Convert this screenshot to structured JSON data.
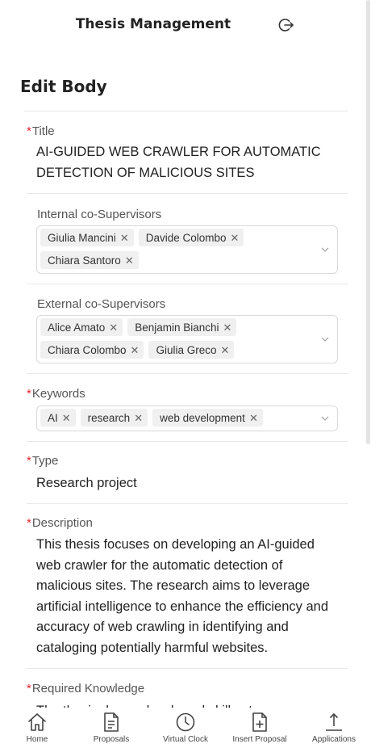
{
  "header": {
    "title": "Thesis Management",
    "logout_icon": "logout-icon"
  },
  "page": {
    "title": "Edit Body"
  },
  "form": {
    "title": {
      "label": "Title",
      "required": "*",
      "value": "AI-GUIDED WEB CRAWLER FOR AUTOMATIC DETECTION OF MALICIOUS SITES"
    },
    "internal": {
      "label": "Internal co-Supervisors",
      "tags": [
        "Giulia Mancini",
        "Davide Colombo",
        "Chiara Santoro"
      ]
    },
    "external": {
      "label": "External co-Supervisors",
      "tags": [
        "Alice Amato",
        "Benjamin Bianchi",
        "Chiara Colombo",
        "Giulia Greco"
      ]
    },
    "keywords": {
      "label": "Keywords",
      "required": "*",
      "tags": [
        "AI",
        "research",
        "web development"
      ]
    },
    "type": {
      "label": "Type",
      "required": "*",
      "value": "Research project"
    },
    "description": {
      "label": "Description",
      "required": "*",
      "value": "This thesis focuses on developing an AI-guided web crawler for the automatic detection of malicious sites. The research aims to leverage artificial intelligence to enhance the efficiency and accuracy of web crawling in identifying and cataloging potentially harmful websites."
    },
    "required_knowledge": {
      "label": "Required Knowledge",
      "required": "*",
      "value": "The thesis demands a broad skill set"
    }
  },
  "nav": [
    {
      "label": "Home",
      "icon": "home-icon"
    },
    {
      "label": "Proposals",
      "icon": "document-icon"
    },
    {
      "label": "Virtual Clock",
      "icon": "clock-icon"
    },
    {
      "label": "Insert Proposal",
      "icon": "file-add-icon"
    },
    {
      "label": "Applications",
      "icon": "upload-icon"
    }
  ],
  "colors": {
    "required": "#e4252f",
    "tag_bg": "#f0f0f0",
    "border": "#d9d9d9"
  }
}
